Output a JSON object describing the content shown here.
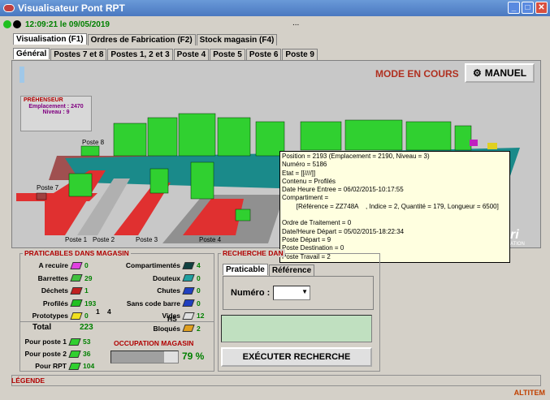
{
  "window": {
    "title": "Visualisateur Pont RPT",
    "clock": "12:09:21 le 09/05/2019",
    "ellipsis": "..."
  },
  "main_tabs": [
    "Visualisation (F1)",
    "Ordres de Fabrication (F2)",
    "Stock magasin (F4)"
  ],
  "sub_tabs": [
    "Général",
    "Postes 7 et 8",
    "Postes 1, 2 et 3",
    "Poste 4",
    "Poste 5",
    "Poste 6",
    "Poste 9"
  ],
  "mode": {
    "label": "MODE EN COURS",
    "button": "MANUEL"
  },
  "preneur": {
    "title": "PRÉHENSEUR",
    "emplacement": "Emplacement : 2470",
    "niveau": "Niveau : 9"
  },
  "scene_labels": {
    "poste8": "Poste 8",
    "poste7": "Poste 7",
    "poste1": "Poste 1",
    "poste2": "Poste 2",
    "poste3": "Poste 3",
    "poste4": "Poste 4",
    "lab1": "1",
    "lab4": "4",
    "brand": "ri",
    "brand_sub": "ATION"
  },
  "tooltip": [
    "Position = 2193 (Emplacement = 2190, Niveau = 3)",
    "Numéro = 5186",
    "Etat = [[////]]",
    "Contenu = Profilés",
    "Date Heure Entree = 06/02/2015-10:17:55",
    "Compartiment =",
    "        [Référence = ZZ748A    , Indice = 2, Quantité = 179, Longueur = 6500]",
    "",
    "Ordre de Traitement = 0",
    "Date/Heure Départ = 05/02/2015-18:22:34",
    "Poste Départ = 9",
    "Poste Destination = 0",
    "Poste Travail = 2"
  ],
  "praticables": {
    "title": "PRATICABLES DANS MAGASIN",
    "left": [
      {
        "label": "A recuire",
        "value": "0",
        "color": "#e040e0"
      },
      {
        "label": "Barrettes",
        "value": "29",
        "color": "#40c040"
      },
      {
        "label": "Déchets",
        "value": "1",
        "color": "#c02020"
      },
      {
        "label": "Profilés",
        "value": "193",
        "color": "#20c020"
      },
      {
        "label": "Prototypes",
        "value": "0",
        "color": "#f0e020"
      }
    ],
    "right": [
      {
        "label": "Compartimentés",
        "value": "4",
        "color": "#104040"
      },
      {
        "label": "Douteux",
        "value": "0",
        "color": "#20a0a0"
      },
      {
        "label": "Chutes",
        "value": "0",
        "color": "#2040c0"
      },
      {
        "label": "Sans code barre",
        "value": "0",
        "color": "#2040c0"
      },
      {
        "label": "Vides",
        "value": "12",
        "color": "#e0e0e0"
      },
      {
        "label": "Bloqués",
        "value": "2",
        "color": "#e0a020"
      }
    ],
    "chutes_hs": "HS",
    "total_label": "Total",
    "total": "223",
    "postes": [
      {
        "label": "Pour poste 1",
        "value": "53"
      },
      {
        "label": "Pour poste 2",
        "value": "36"
      },
      {
        "label": "Pour RPT",
        "value": "104"
      }
    ],
    "occupation_title": "OCCUPATION MAGASIN",
    "occupation": "79 %",
    "occupation_fraction": 0.79
  },
  "recherche": {
    "title": "RECHERCHE DAN",
    "tabs": [
      "Praticable",
      "Référence"
    ],
    "numero_label": "Numéro :",
    "button": "EXÉCUTER RECHERCHE"
  },
  "legend": "LÉGENDE",
  "footer_brand": "ALTITEM"
}
